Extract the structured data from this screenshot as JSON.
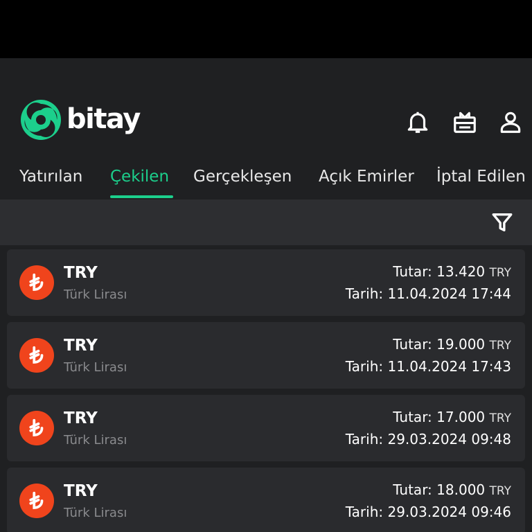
{
  "brand": {
    "name": "bitay",
    "accent": "#1ccf8c"
  },
  "header": {
    "icons": [
      "bell-icon",
      "gift-icon",
      "user-icon"
    ]
  },
  "tabs": [
    {
      "label": "Yatırılan",
      "active": false
    },
    {
      "label": "Çekilen",
      "active": true
    },
    {
      "label": "Gerçekleşen",
      "active": false
    },
    {
      "label": "Açık Emirler",
      "active": false
    },
    {
      "label": "İptal Edilen",
      "active": false
    }
  ],
  "filter": {
    "icon": "filter-icon"
  },
  "transactions": [
    {
      "symbol": "TRY",
      "name": "Türk Lirası",
      "amount_label": "Tutar:",
      "amount": "13.420",
      "currency": "TRY",
      "date_label": "Tarih:",
      "date": "11.04.2024 17:44"
    },
    {
      "symbol": "TRY",
      "name": "Türk Lirası",
      "amount_label": "Tutar:",
      "amount": "19.000",
      "currency": "TRY",
      "date_label": "Tarih:",
      "date": "11.04.2024 17:43"
    },
    {
      "symbol": "TRY",
      "name": "Türk Lirası",
      "amount_label": "Tutar:",
      "amount": "17.000",
      "currency": "TRY",
      "date_label": "Tarih:",
      "date": "29.03.2024 09:48"
    },
    {
      "symbol": "TRY",
      "name": "Türk Lirası",
      "amount_label": "Tutar:",
      "amount": "18.000",
      "currency": "TRY",
      "date_label": "Tarih:",
      "date": "29.03.2024 09:46"
    }
  ],
  "colors": {
    "coin": "#f0441c",
    "background": "#1f2022",
    "card": "#2a2b2e",
    "filterbar": "#2d2e31"
  }
}
